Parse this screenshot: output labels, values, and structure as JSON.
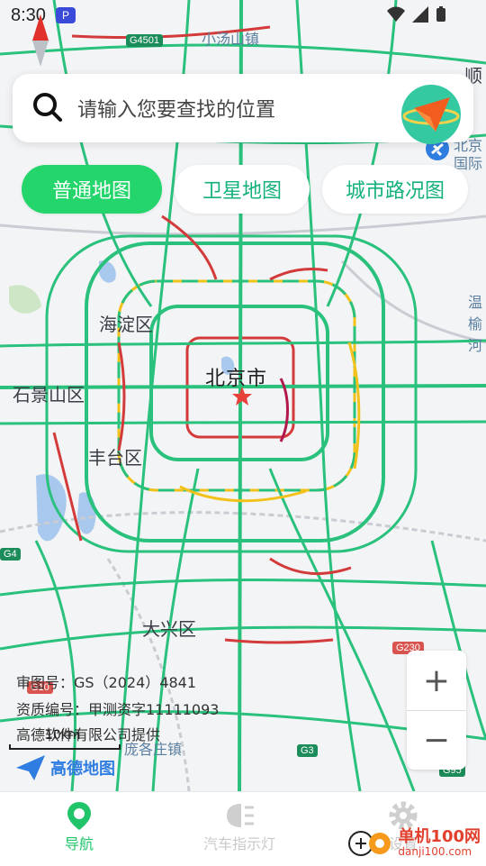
{
  "status_bar": {
    "time": "8:30",
    "app_badge": "P"
  },
  "search": {
    "placeholder": "请输入您要查找的位置"
  },
  "tabs": [
    {
      "label": "普通地图",
      "active": true
    },
    {
      "label": "卫星地图",
      "active": false
    },
    {
      "label": "城市路况图",
      "active": false
    }
  ],
  "map": {
    "city_label": "北京市",
    "districts": [
      "海淀区",
      "石景山区",
      "丰台区",
      "大兴区"
    ],
    "places": [
      "小汤山镇",
      "顺",
      "北京",
      "国际",
      "温",
      "榆",
      "河",
      "庞各庄镇"
    ],
    "road_shields": [
      "G4501",
      "G4",
      "G230",
      "G3",
      "G95",
      "G10"
    ],
    "credits": {
      "review_no": "审图号：GS（2024）4841",
      "license": "资质编号：甲测资字11111093",
      "provider": "高德软件有限公司提供"
    },
    "scale_label": "10km",
    "logo_text": "高德地图",
    "zoom_in": "+",
    "zoom_out": "−"
  },
  "bottom_nav": [
    {
      "label": "导航",
      "icon": "location-pin-icon",
      "active": true
    },
    {
      "label": "汽车指示灯",
      "icon": "headlight-icon",
      "active": false
    },
    {
      "label": "设置",
      "icon": "gear-icon",
      "active": false
    }
  ],
  "watermark": {
    "title": "单机100网",
    "url": "danji100.com"
  },
  "colors": {
    "accent": "#23d56a",
    "road_green": "#29c17c",
    "road_red": "#d33b3b",
    "road_yellow": "#f2c21b"
  }
}
